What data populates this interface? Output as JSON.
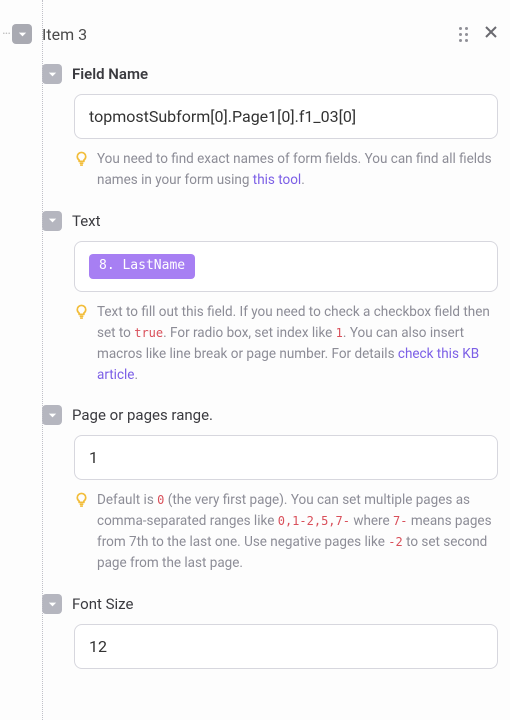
{
  "item": {
    "title": "Item 3"
  },
  "fieldName": {
    "label": "Field Name",
    "value": "topmostSubform[0].Page1[0].f1_03[0]",
    "hint_pre": "You need to find exact names of form fields. You can find all fields names in your form using ",
    "hint_link": "this tool",
    "hint_post": "."
  },
  "text": {
    "label": "Text",
    "token": "8. LastName",
    "hint_a": "Text to fill out this field. If you need to check a checkbox field then set to ",
    "code_true": "true",
    "hint_b": ". For radio box, set index like ",
    "code_1": "1",
    "hint_c": ". You can also insert macros like line break or page number. For details ",
    "hint_link": "check this KB article",
    "hint_d": "."
  },
  "page": {
    "label": "Page or pages range.",
    "value": "1",
    "hint_a": "Default is ",
    "code_0": "0",
    "hint_b": " (the very first page). You can set multiple pages as comma-separated ranges like ",
    "code_range": "0,1-2,5,7-",
    "hint_c": " where ",
    "code_7": "7-",
    "hint_d": " means pages from 7th to the last one. Use negative pages like ",
    "code_neg2": "-2",
    "hint_e": " to set second page from the last page."
  },
  "fontSize": {
    "label": "Font Size",
    "value": "12"
  }
}
